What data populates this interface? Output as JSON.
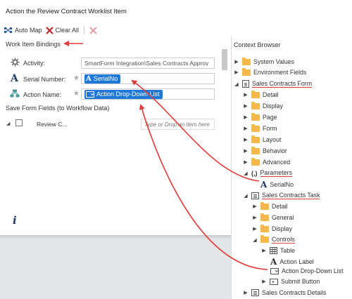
{
  "title": "Action the Review Contract Worklist Item",
  "toolbar": {
    "auto_map": "Auto Map",
    "clear_all": "Clear All"
  },
  "work_item_bindings": {
    "label": "Work Item Bindings",
    "rows": [
      {
        "label": "Activity:",
        "value": "SmartForm Integration\\Sales Contracts Approv"
      },
      {
        "label": "Serial Number:",
        "chip": "SerialNo"
      },
      {
        "label": "Action Name:",
        "chip": "Action Drop-Down List"
      }
    ]
  },
  "save_form_fields": {
    "label": "Save Form Fields (to Workflow Data)",
    "item": "Review C...",
    "placeholder": "Type or Drop an item here"
  },
  "info_icon": "i",
  "context_browser": {
    "title": "Context Browser",
    "items": [
      {
        "label": "System Values"
      },
      {
        "label": "Environment Fields"
      },
      {
        "label": "Sales Contracts Form"
      },
      {
        "label": "Detail"
      },
      {
        "label": "Display"
      },
      {
        "label": "Page"
      },
      {
        "label": "Form"
      },
      {
        "label": "Layout"
      },
      {
        "label": "Behavior"
      },
      {
        "label": "Advanced"
      },
      {
        "label": "Parameters"
      },
      {
        "label": "SerialNo"
      },
      {
        "label": "Sales Contracts Task"
      },
      {
        "label": "Detail"
      },
      {
        "label": "General"
      },
      {
        "label": "Display"
      },
      {
        "label": "Controls"
      },
      {
        "label": "Table"
      },
      {
        "label": "Action Label"
      },
      {
        "label": "Action Drop-Down List"
      },
      {
        "label": "Submit Button"
      },
      {
        "label": "Sales Contracts Details"
      }
    ]
  },
  "colors": {
    "accent": "#1e78d8",
    "annotation": "#e23b3b",
    "folder": "#f5b84a"
  }
}
